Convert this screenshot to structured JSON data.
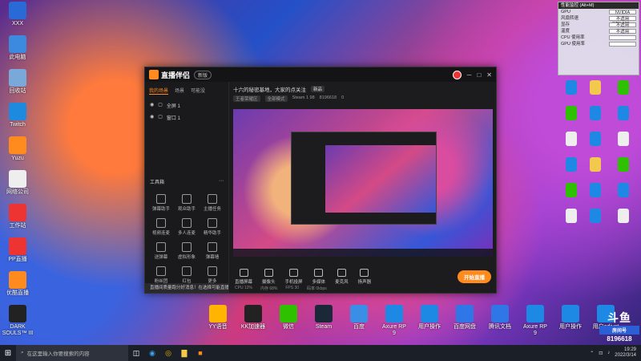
{
  "desktop_left": [
    {
      "label": "XXX",
      "icon": "x-icon",
      "color": "#2a6ad6"
    },
    {
      "label": "此电脑",
      "icon": "computer-icon",
      "color": "#3b8ae0"
    },
    {
      "label": "回收站",
      "icon": "recycle-icon",
      "color": "#7aa8d8"
    },
    {
      "label": "Twitch",
      "icon": "bird-icon",
      "color": "#1d8ae0"
    },
    {
      "label": "Yuzu",
      "icon": "g-icon",
      "color": "#ff8a1d"
    },
    {
      "label": "网络公司",
      "icon": "doc-icon",
      "color": "#eee"
    },
    {
      "label": "工作站",
      "icon": "doc-icon",
      "color": "#e33"
    },
    {
      "label": "PP直播",
      "icon": "pp-icon",
      "color": "#e33"
    },
    {
      "label": "优酷直播",
      "icon": "tv-icon",
      "color": "#ff8a1d"
    },
    {
      "label": "DARK SOULS™ III",
      "icon": "ds-icon",
      "color": "#222"
    }
  ],
  "gpu_widget": {
    "title": "性能监控 (Alt+M)",
    "rows": [
      {
        "k": "GPU",
        "v": "NVIDIA GeForce GTX 166..."
      },
      {
        "k": "风扇转速",
        "v": "不适用"
      },
      {
        "k": "显存",
        "v": "不适用"
      },
      {
        "k": "温度",
        "v": "不适用"
      },
      {
        "k": "CPU 使用率",
        "v": ""
      },
      {
        "k": "GPU 使用率",
        "v": ""
      }
    ]
  },
  "app": {
    "name": "直播伴侣",
    "version": "新版",
    "sidebar_tabs": [
      "我的场景",
      "场景",
      "可能没"
    ],
    "scenes": [
      "全屏 1",
      "窗口 1"
    ],
    "tools_title": "工具箱",
    "tools": [
      "弹幕助手",
      "观众助手",
      "主播任务",
      "视频连麦",
      "多人连麦",
      "精华助手",
      "送弹幕",
      "虚拟形象",
      "弹幕墙",
      "粉丝团",
      "红包",
      "更多"
    ],
    "notice": "直播间质量跑分好消息！在选择可能直播间的问题时可能跑我",
    "room_title": "十六的秘密基地，大家的点关注",
    "room_tag": "新品",
    "room_info": [
      "王者荣耀区",
      "全部模式",
      "Steam 1 98",
      "8196618"
    ],
    "room_likes": "0",
    "controls": [
      "直播屏幕",
      "摄像头",
      "手机投屏",
      "多媒体",
      "麦克风",
      "扬声器"
    ],
    "live_button": "开始直播",
    "status": [
      "CPU 12%",
      "内存 68%",
      "FPS 30",
      "码率 0kbps"
    ]
  },
  "dock": [
    {
      "label": "YY语音",
      "icon": "yy-icon",
      "color": "#ffb400"
    },
    {
      "label": "KK加速器",
      "icon": "kk-icon",
      "color": "#222"
    },
    {
      "label": "微信",
      "icon": "wechat-icon",
      "color": "#2dc100"
    },
    {
      "label": "Steam",
      "icon": "steam-icon",
      "color": "#1b2838"
    },
    {
      "label": "百度",
      "icon": "plane-icon",
      "color": "#3a8ee6"
    },
    {
      "label": "Axure RP 9",
      "icon": "axure-icon",
      "color": "#1e88e5"
    },
    {
      "label": "用户操作",
      "icon": "doc-icon",
      "color": "#1e88e5"
    },
    {
      "label": "百度网盘",
      "icon": "cloud-icon",
      "color": "#2f76e6"
    },
    {
      "label": "腾讯文档",
      "icon": "doc-icon",
      "color": "#2f76e6"
    },
    {
      "label": "Axure RP 9",
      "icon": "axure-icon",
      "color": "#1e88e5"
    },
    {
      "label": "用户操作",
      "icon": "doc-icon",
      "color": "#1e88e5"
    },
    {
      "label": "用户adjust",
      "icon": "doc-icon",
      "color": "#1e88e5"
    }
  ],
  "taskbar": {
    "search_placeholder": "在这里输入你要搜索的内容",
    "time": "19:29",
    "date": "2022/3/14"
  },
  "watermark": {
    "brand": "斗鱼",
    "sub": "房间号",
    "room": "8196618"
  }
}
